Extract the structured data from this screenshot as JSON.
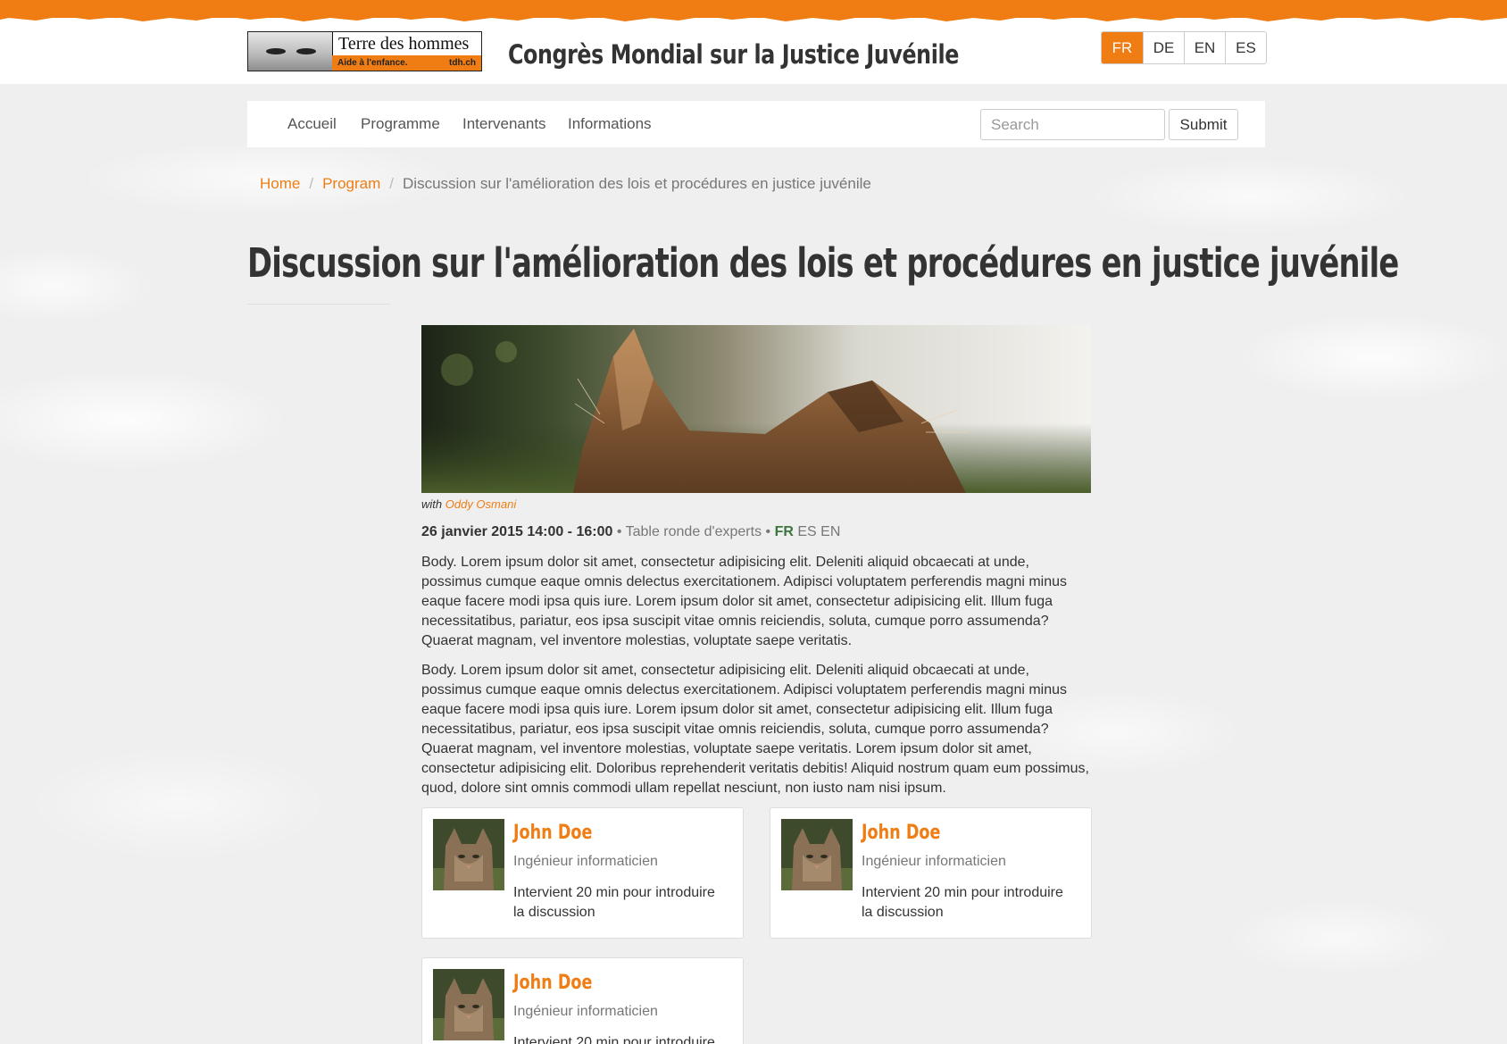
{
  "header": {
    "logo": {
      "name": "Terre des hommes",
      "tagline": "Aide à l'enfance.",
      "domain": "tdh.ch"
    },
    "site_title": "Congrès Mondial sur la Justice Juvénile",
    "languages": [
      {
        "label": "FR",
        "active": true
      },
      {
        "label": "DE",
        "active": false
      },
      {
        "label": "EN",
        "active": false
      },
      {
        "label": "ES",
        "active": false
      }
    ]
  },
  "nav": {
    "items": [
      {
        "label": "Accueil"
      },
      {
        "label": "Programme"
      },
      {
        "label": "Intervenants"
      },
      {
        "label": "Informations"
      }
    ],
    "search_placeholder": "Search",
    "submit_label": "Submit"
  },
  "breadcrumb": {
    "items": [
      {
        "label": "Home"
      },
      {
        "label": "Program"
      }
    ],
    "current": "Discussion sur l'amélioration des lois et procédures en justice juvénile"
  },
  "article": {
    "title": "Discussion sur l'amélioration des lois et procédures en justice juvénile",
    "hero_image": "cat-ears-photo",
    "caption_prefix": "with",
    "caption_speaker": "Oddy Osmani",
    "date": "26 janvier 2015 14:00 - 16:00",
    "bullet": "•",
    "session_type": "Table ronde d'experts",
    "languages_active": "FR",
    "languages_other": "ES EN",
    "paragraphs": [
      "Body. Lorem ipsum dolor sit amet, consectetur adipisicing elit. Deleniti aliquid obcaecati at unde, possimus cumque eaque omnis delectus exercitationem. Adipisci voluptatem perferendis magni minus eaque facere modi ipsa quis iure. Lorem ipsum dolor sit amet, consectetur adipisicing elit. Illum fuga necessitatibus, pariatur, eos ipsa suscipit vitae omnis reiciendis, soluta, cumque porro assumenda? Quaerat magnam, vel inventore molestias, voluptate saepe veritatis.",
      "Body. Lorem ipsum dolor sit amet, consectetur adipisicing elit. Deleniti aliquid obcaecati at unde, possimus cumque eaque omnis delectus exercitationem. Adipisci voluptatem perferendis magni minus eaque facere modi ipsa quis iure. Lorem ipsum dolor sit amet, consectetur adipisicing elit. Illum fuga necessitatibus, pariatur, eos ipsa suscipit vitae omnis reiciendis, soluta, cumque porro assumenda? Quaerat magnam, vel inventore molestias, voluptate saepe veritatis. Lorem ipsum dolor sit amet, consectetur adipisicing elit. Doloribus reprehenderit veritatis debitis! Aliquid nostrum quam eum possimus, quod, dolore sint omnis commodi ullam repellat nesciunt, non iusto nam nisi ipsum."
    ]
  },
  "speakers": [
    {
      "name": "John Doe",
      "role": "Ingénieur informaticien",
      "description": "Intervient 20 min pour introduire la discussion"
    },
    {
      "name": "John Doe",
      "role": "Ingénieur informaticien",
      "description": "Intervient 20 min pour introduire la discussion"
    },
    {
      "name": "John Doe",
      "role": "Ingénieur informaticien",
      "description": "Intervient 20 min pour introduire"
    }
  ],
  "colors": {
    "accent": "#ef7d13",
    "language_active": "#3c763d",
    "background": "#efefef"
  }
}
